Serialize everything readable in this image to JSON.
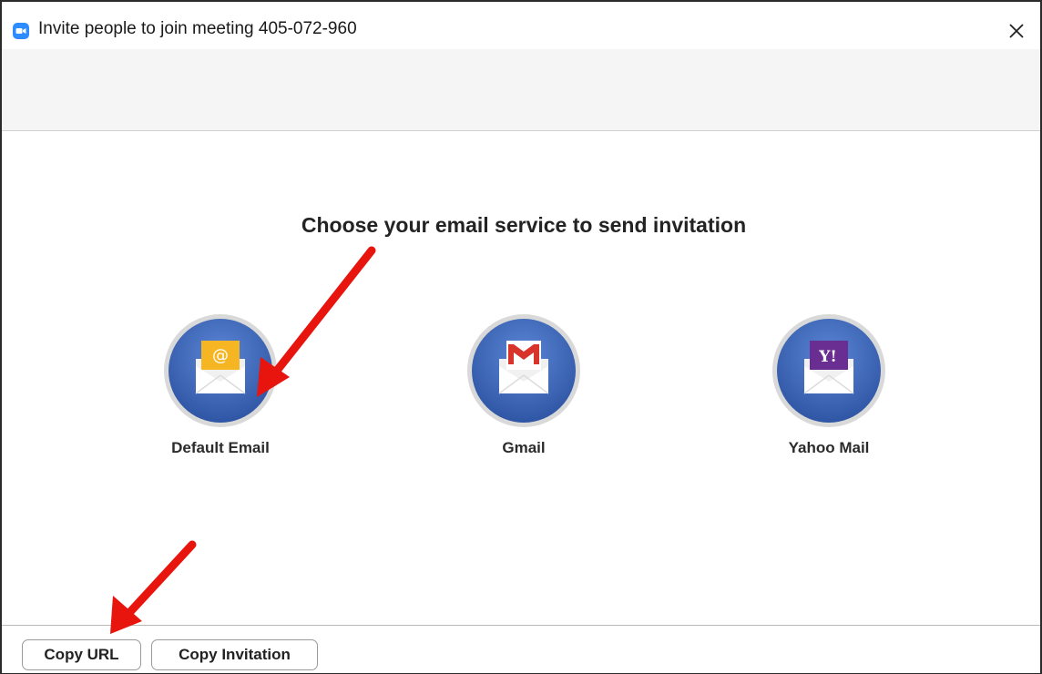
{
  "window": {
    "title": "Invite people to join meeting 405-072-960",
    "close_icon": "close-icon",
    "app_icon": "zoom-camera-icon"
  },
  "main": {
    "heading": "Choose your email service to send invitation",
    "services": [
      {
        "label": "Default Email",
        "icon": "envelope-at-icon"
      },
      {
        "label": "Gmail",
        "icon": "gmail-envelope-icon"
      },
      {
        "label": "Yahoo Mail",
        "icon": "yahoo-envelope-icon"
      }
    ]
  },
  "footer": {
    "copy_url_label": "Copy URL",
    "copy_invitation_label": "Copy Invitation"
  },
  "annotations": {
    "arrow_color": "#e8140e"
  },
  "colors": {
    "circle_blue": "#3f69b8",
    "circle_ring": "#d6d6d6",
    "default_email_yellow": "#f6b623",
    "gmail_red": "#d8342c",
    "yahoo_purple": "#6a2d91"
  }
}
